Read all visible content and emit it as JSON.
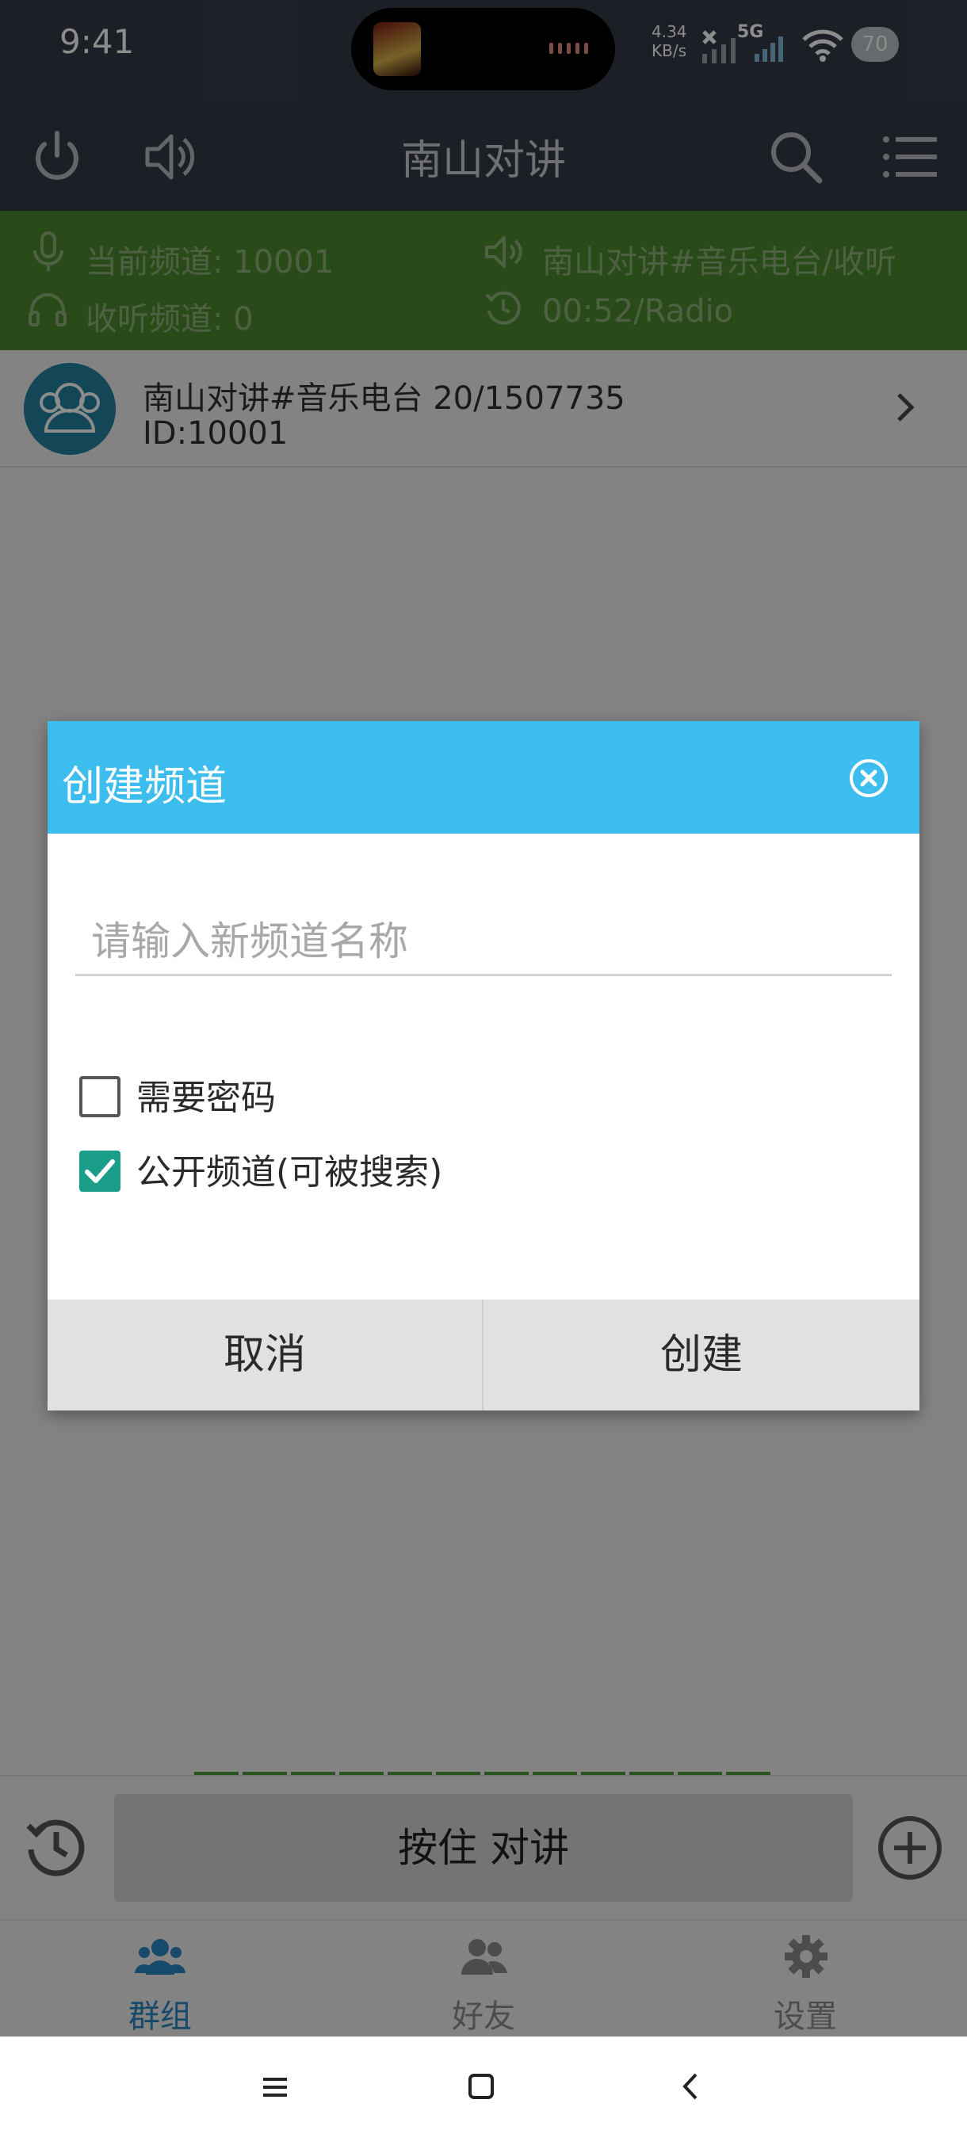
{
  "status_bar": {
    "time": "9:41",
    "net_speed_value": "4.34",
    "net_speed_unit": "KB/s",
    "network_type": "5G",
    "battery": "70"
  },
  "app_bar": {
    "title": "南山对讲",
    "icons": [
      "power-icon",
      "speaker-icon",
      "search-icon",
      "menu-icon"
    ]
  },
  "info_bar": {
    "current_channel": "当前频道: 10001",
    "listen_channel": "收听频道: 0",
    "now_playing": "南山对讲#音乐电台/收听",
    "timer": "00:52/Radio"
  },
  "channel": {
    "name": "南山对讲#音乐电台 20/1507735",
    "id": "ID:10001"
  },
  "ptt": {
    "label": "按住 对讲"
  },
  "tabs": [
    {
      "label": "群组",
      "icon": "group-icon",
      "active": true
    },
    {
      "label": "好友",
      "icon": "friends-icon",
      "active": false
    },
    {
      "label": "设置",
      "icon": "settings-gear-icon",
      "active": false
    }
  ],
  "dialog": {
    "title": "创建频道",
    "input_placeholder": "请输入新频道名称",
    "input_value": "",
    "require_password": {
      "label": "需要密码",
      "checked": false
    },
    "public_channel": {
      "label": "公开频道(可被搜索)",
      "checked": true
    },
    "cancel_label": "取消",
    "create_label": "创建"
  },
  "colors": {
    "header": "#353a45",
    "info_bar": "#4c892e",
    "dialog_header": "#3cbdee",
    "checkbox_checked": "#1a9e8a",
    "tab_active": "#2b86c2",
    "tab_inactive": "#8a8a8a"
  }
}
